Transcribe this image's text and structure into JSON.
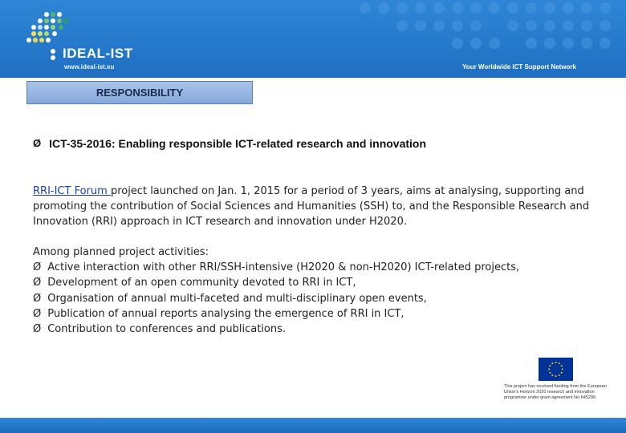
{
  "header": {
    "brand_name": "IDEAL-IST",
    "brand_url": "www.ideal-ist.eu",
    "tagline": "Your Worldwide ICT Support Network"
  },
  "section_title": "RESPONSIBILITY",
  "topic": {
    "bullet": "Ø",
    "text": "ICT-35-2016: Enabling responsible ICT-related research and innovation"
  },
  "paragraph": {
    "link_text": "RRI-ICT Forum ",
    "body": "project launched on Jan. 1, 2015 for a period of 3 years, aims at analysing, supporting and promoting the contribution of Social Sciences and Humanities (SSH) to, and the Responsible Research and Innovation (RRI) approach in ICT research and innovation under H2020."
  },
  "activities": {
    "intro": "Among planned project activities:",
    "items": [
      "Active interaction with other RRI/SSH-intensive (H2020 & non-H2020) ICT-related projects,",
      "Development of an open community devoted to RRI in ICT,",
      "Organisation of annual multi-faceted and multi-disciplinary open events,",
      "Publication of annual reports analysing the emergence of RRI in ICT,",
      "Contribution to conferences and publications."
    ]
  },
  "eu_notice": "This project has received funding from the European Union's Horizon 2020 research and innovation programme under grant agreement No 645296",
  "colors": {
    "header_blue": "#2f86d6",
    "section_box": "#a9c4ea",
    "link": "#1a3fb0",
    "eu_blue": "#003399",
    "eu_star": "#ffcc00"
  }
}
